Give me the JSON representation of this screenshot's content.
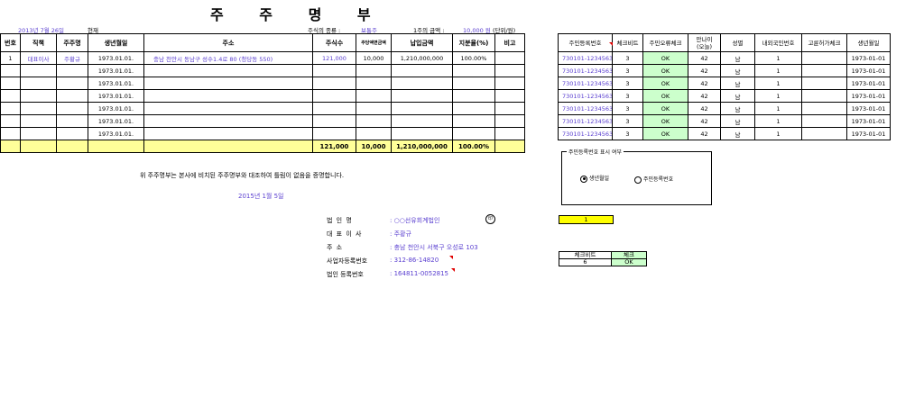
{
  "header": {
    "title": "주 주 명 부",
    "date": "2013년 7월 26일",
    "as_of": "현재",
    "stock_type_label": "주식의 종류 :",
    "stock_type_value": "보통주",
    "par_value_label": "1주의 금액 :",
    "par_value_value": "10,000 원",
    "unit": "(단위/원)"
  },
  "main_table": {
    "columns": [
      "번호",
      "직책",
      "주주명",
      "생년월일",
      "주소",
      "주식수",
      "주당액면금액",
      "납입금액",
      "지분율(%)",
      "비고"
    ],
    "rows": [
      {
        "no": "1",
        "position": "대표이사",
        "name": "주황규",
        "birth": "1973.01.01.",
        "address": "충남 천안시 동남구 성수1.4로 80 (청당동 550)",
        "shares": "121,000",
        "par": "10,000",
        "paid": "1,210,000,000",
        "ratio": "100.00%",
        "note": ""
      },
      {
        "no": "",
        "position": "",
        "name": "",
        "birth": "1973.01.01.",
        "address": "",
        "shares": "",
        "par": "",
        "paid": "",
        "ratio": "",
        "note": ""
      },
      {
        "no": "",
        "position": "",
        "name": "",
        "birth": "1973.01.01.",
        "address": "",
        "shares": "",
        "par": "",
        "paid": "",
        "ratio": "",
        "note": ""
      },
      {
        "no": "",
        "position": "",
        "name": "",
        "birth": "1973.01.01.",
        "address": "",
        "shares": "",
        "par": "",
        "paid": "",
        "ratio": "",
        "note": ""
      },
      {
        "no": "",
        "position": "",
        "name": "",
        "birth": "1973.01.01.",
        "address": "",
        "shares": "",
        "par": "",
        "paid": "",
        "ratio": "",
        "note": ""
      },
      {
        "no": "",
        "position": "",
        "name": "",
        "birth": "1973.01.01.",
        "address": "",
        "shares": "",
        "par": "",
        "paid": "",
        "ratio": "",
        "note": ""
      },
      {
        "no": "",
        "position": "",
        "name": "",
        "birth": "1973.01.01.",
        "address": "",
        "shares": "",
        "par": "",
        "paid": "",
        "ratio": "",
        "note": ""
      }
    ],
    "total": {
      "shares": "121,000",
      "par": "10,000",
      "paid": "1,210,000,000",
      "ratio": "100.00%"
    }
  },
  "certification": "위 주주명부는 본사에 비치된 주주명부와 대조하여 틀림이 없음을 증명합니다.",
  "issue_date": "2015년 1월 5일",
  "company_info": [
    {
      "label": "법    인    명",
      "value": ": ○○선유회계법인"
    },
    {
      "label": "대  표  이  사",
      "value": ": 주황규"
    },
    {
      "label": "주            소",
      "value": ": 충남 천안시 서북구 오성로 103"
    },
    {
      "label": "사업자등록번호",
      "value": ": 312-86-14820"
    },
    {
      "label": "법인 등록번호",
      "value": ": 164811-0052815"
    }
  ],
  "seal_text": "印",
  "resident_table": {
    "columns": [
      "주민등록번호",
      "체크비트",
      "주민오류체크",
      "만나이\n(오늘)",
      "성별",
      "내외국인번호",
      "고륜허가체크",
      "생년월일"
    ],
    "rows": [
      {
        "reg": "730101-1234563",
        "bit": "3",
        "check": "OK",
        "age": "42",
        "sex": "남",
        "foreign": "1",
        "perm": "",
        "birth": "1973-01-01"
      },
      {
        "reg": "730101-1234563",
        "bit": "3",
        "check": "OK",
        "age": "42",
        "sex": "남",
        "foreign": "1",
        "perm": "",
        "birth": "1973-01-01"
      },
      {
        "reg": "730101-1234563",
        "bit": "3",
        "check": "OK",
        "age": "42",
        "sex": "남",
        "foreign": "1",
        "perm": "",
        "birth": "1973-01-01"
      },
      {
        "reg": "730101-1234563",
        "bit": "3",
        "check": "OK",
        "age": "42",
        "sex": "남",
        "foreign": "1",
        "perm": "",
        "birth": "1973-01-01"
      },
      {
        "reg": "730101-1234563",
        "bit": "3",
        "check": "OK",
        "age": "42",
        "sex": "남",
        "foreign": "1",
        "perm": "",
        "birth": "1973-01-01"
      },
      {
        "reg": "730101-1234563",
        "bit": "3",
        "check": "OK",
        "age": "42",
        "sex": "남",
        "foreign": "1",
        "perm": "",
        "birth": "1973-01-01"
      },
      {
        "reg": "730101-1234563",
        "bit": "3",
        "check": "OK",
        "age": "42",
        "sex": "남",
        "foreign": "1",
        "perm": "",
        "birth": "1973-01-01"
      }
    ]
  },
  "display_option": {
    "legend": "주민등록번호 표시 여부",
    "options": [
      {
        "label": "생년월일",
        "selected": true
      },
      {
        "label": "주민등록번호",
        "selected": false
      }
    ]
  },
  "selector_value": "1",
  "check_box": {
    "headers": [
      "체크비트",
      "체크"
    ],
    "values": [
      "6",
      "OK"
    ]
  },
  "colors": {
    "accent_text": "#5a3fd0",
    "total_row": "#ffff99",
    "ok_cell": "#ccffcc",
    "selector": "#ffff00",
    "mark": "#e00000"
  }
}
